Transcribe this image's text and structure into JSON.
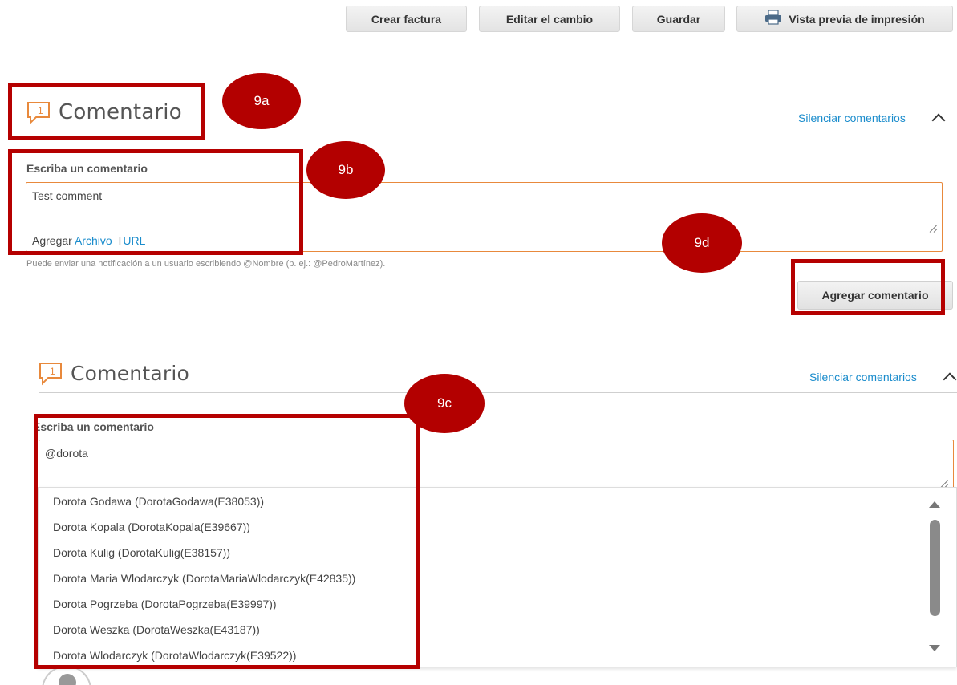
{
  "toolbar": {
    "create_invoice": "Crear factura",
    "edit_change": "Editar el cambio",
    "save": "Guardar",
    "print_preview": "Vista previa de impresión"
  },
  "comment_panel_1": {
    "badge": "1",
    "title": "Comentario",
    "mute_link": "Silenciar comentarios",
    "field_label": "Escriba un comentario",
    "textarea_value": "Test comment",
    "attach_prefix": "Agregar",
    "attach_file": "Archivo",
    "attach_separator": "I",
    "attach_url": "URL",
    "hint": "Puede enviar una notificación a un usuario escribiendo @Nombre (p. ej.: @PedroMartínez).",
    "add_button": "Agregar comentario"
  },
  "comment_panel_2": {
    "badge": "1",
    "title": "Comentario",
    "mute_link": "Silenciar comentarios",
    "field_label": "Escriba un comentario",
    "textarea_value": "@dorota",
    "suggestions": [
      "Dorota Godawa (DorotaGodawa(E38053))",
      "Dorota Kopala (DorotaKopala(E39667))",
      "Dorota Kulig (DorotaKulig(E38157))",
      "Dorota Maria Wlodarczyk (DorotaMariaWlodarczyk(E42835))",
      "Dorota Pogrzeba (DorotaPogrzeba(E39997))",
      "Dorota Weszka (DorotaWeszka(E43187))",
      "Dorota Wlodarczyk (DorotaWlodarczyk(E39522))"
    ]
  },
  "annotations": {
    "a": "9a",
    "b": "9b",
    "c": "9c",
    "d": "9d"
  },
  "colors": {
    "annotation_red": "#b50000",
    "link_blue": "#1a8ccc",
    "input_border_orange": "#e8893c",
    "comment_icon_orange": "#e8893c"
  },
  "icons": {
    "print": "printer-icon",
    "comment": "comment-bubble-icon",
    "collapse": "chevron-up-icon"
  }
}
